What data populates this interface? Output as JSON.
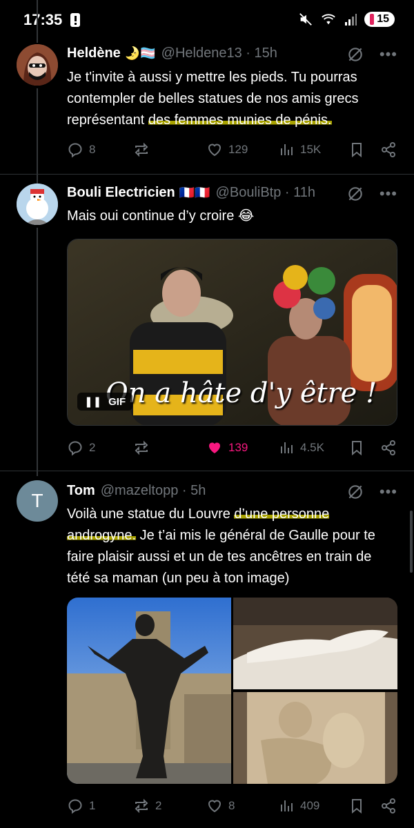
{
  "status_bar": {
    "time": "17:35",
    "battery": "15"
  },
  "tweets": [
    {
      "name": "Heldène",
      "badge_emoji": "🌛🏳️‍⚧️",
      "handle": "@Heldene13 · 15h",
      "text_before": "Je t'invite à aussi y mettre les pieds. Tu pourras contempler de belles statues de nos amis grecs représentant ",
      "text_highlight": "des femmes munies de pénis.",
      "text_after": "",
      "replies": "8",
      "retweets": "",
      "likes": "129",
      "views": "15K"
    },
    {
      "name": "Bouli Electricien",
      "badge_emoji": "🇫🇷🇫🇷",
      "handle": "@BouliBtp · 11h",
      "text_before": "Mais oui continue d’y croire 😂",
      "text_highlight": "",
      "text_after": "",
      "gif_caption": "On a hâte d'y être !",
      "gif_label": "GIF",
      "replies": "2",
      "retweets": "",
      "likes": "139",
      "views": "4.5K"
    },
    {
      "name": "Tom",
      "avatar_letter": "T",
      "handle": "@mazeltopp · 5h",
      "text_before": "Voilà une statue du Louvre ",
      "text_highlight": "d’une personne androgyne.",
      "text_after": " Je t’ai mis le général de Gaulle pour te faire plaisir aussi et un de tes ancêtres en train de tété sa maman (un peu à ton image)",
      "replies": "1",
      "retweets": "2",
      "likes": "8",
      "views": "409"
    }
  ],
  "colors": {
    "background": "#000000",
    "text": "#e7e9ea",
    "muted": "#71767b",
    "like_active": "#f91880",
    "highlight": "#a8a200",
    "divider": "#2f3336"
  },
  "icons": [
    "reply-icon",
    "retweet-icon",
    "like-icon",
    "views-icon",
    "bookmark-icon",
    "share-icon",
    "grok-icon",
    "more-icon"
  ]
}
